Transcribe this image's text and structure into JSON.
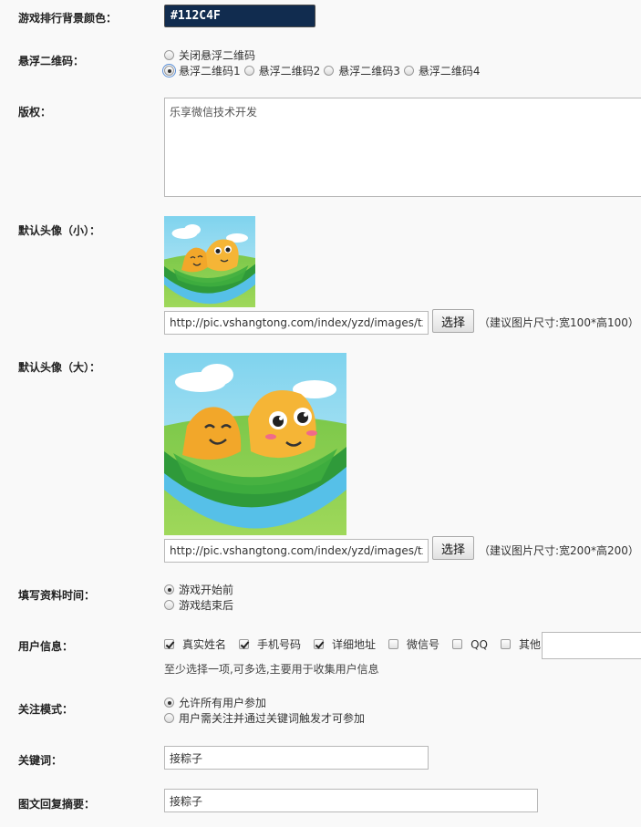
{
  "bg_color": {
    "label": "游戏排行背景颜色：",
    "value": "#112C4F"
  },
  "qrcode": {
    "label": "悬浮二维码：",
    "options": [
      "关闭悬浮二维码",
      "悬浮二维码1",
      "悬浮二维码2",
      "悬浮二维码3",
      "悬浮二维码4"
    ],
    "selected": "悬浮二维码1"
  },
  "copyright": {
    "label": "版权：",
    "value": "乐享微信技术开发"
  },
  "avatar_small": {
    "label": "默认头像（小）：",
    "url": "http://pic.vshangtong.com/index/yzd/images/tx1",
    "button": "选择",
    "hint": "（建议图片尺寸:宽100*高100）"
  },
  "avatar_large": {
    "label": "默认头像（大）：",
    "url": "http://pic.vshangtong.com/index/yzd/images/tx2",
    "button": "选择",
    "hint": "（建议图片尺寸:宽200*高200）"
  },
  "fill_time": {
    "label": "填写资料时间：",
    "options": [
      "游戏开始前",
      "游戏结束后"
    ],
    "selected": "游戏开始前"
  },
  "user_info": {
    "label": "用户信息：",
    "fields": [
      {
        "label": "真实姓名",
        "checked": true
      },
      {
        "label": "手机号码",
        "checked": true
      },
      {
        "label": "详细地址",
        "checked": true
      },
      {
        "label": "微信号",
        "checked": false
      },
      {
        "label": "QQ",
        "checked": false
      },
      {
        "label": "其他",
        "checked": false
      }
    ],
    "other_value": "",
    "note": "至少选择一项,可多选,主要用于收集用户信息"
  },
  "follow_mode": {
    "label": "关注模式：",
    "options": [
      "允许所有用户参加",
      "用户需关注并通过关键词触发才可参加"
    ],
    "selected": "允许所有用户参加"
  },
  "keyword": {
    "label": "关键词：",
    "value": "接粽子"
  },
  "summary": {
    "label": "图文回复摘要：",
    "value": "接粽子"
  }
}
